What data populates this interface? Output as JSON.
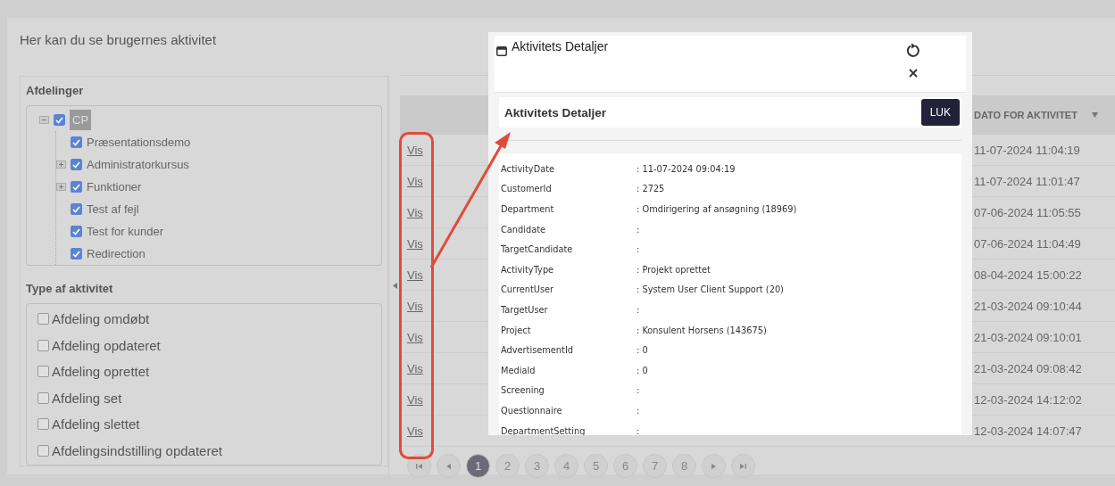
{
  "page": {
    "title": "Her kan du se brugernes aktivitet"
  },
  "departments": {
    "label": "Afdelinger",
    "tree": [
      {
        "label": "CP",
        "checked": true,
        "expanded": true,
        "children": [
          {
            "label": "Præsentationsdemo",
            "checked": true
          },
          {
            "label": "Administratorkursus",
            "checked": true,
            "expanded": false
          },
          {
            "label": "Funktioner",
            "checked": true,
            "expanded": false
          },
          {
            "label": "Test af fejl",
            "checked": true
          },
          {
            "label": "Test for kunder",
            "checked": true
          },
          {
            "label": "Redirection",
            "checked": true
          }
        ]
      }
    ]
  },
  "activity_types": {
    "label": "Type af aktivitet",
    "items": [
      {
        "label": "Afdeling omdøbt",
        "checked": false
      },
      {
        "label": "Afdeling opdateret",
        "checked": false
      },
      {
        "label": "Afdeling oprettet",
        "checked": false
      },
      {
        "label": "Afdeling set",
        "checked": false
      },
      {
        "label": "Afdeling slettet",
        "checked": false
      },
      {
        "label": "Afdelingsindstilling opdateret",
        "checked": false
      }
    ]
  },
  "table": {
    "columns": [
      {
        "label": "DATO FOR AKTIVITET",
        "sorted": true
      }
    ],
    "rows": [
      {
        "link": "Vis",
        "date": "11-07-2024 11:04:19"
      },
      {
        "link": "Vis",
        "date": "11-07-2024 11:01:47"
      },
      {
        "link": "Vis",
        "date": "07-06-2024 11:05:55"
      },
      {
        "link": "Vis",
        "date": "07-06-2024 11:04:49"
      },
      {
        "link": "Vis",
        "date": "08-04-2024 15:00:22"
      },
      {
        "link": "Vis",
        "date": "21-03-2024 09:10:44"
      },
      {
        "link": "Vis",
        "date": "21-03-2024 09:10:01"
      },
      {
        "link": "Vis",
        "date": "21-03-2024 09:08:42"
      },
      {
        "link": "Vis",
        "date": "12-03-2024 14:12:02"
      },
      {
        "link": "Vis",
        "date": "12-03-2024 14:07:47"
      }
    ]
  },
  "pagination": {
    "pages": [
      {
        "label": "1",
        "selected": true
      },
      {
        "label": "2",
        "selected": false
      },
      {
        "label": "3",
        "selected": false
      },
      {
        "label": "4",
        "selected": false
      },
      {
        "label": "5",
        "selected": false
      },
      {
        "label": "6",
        "selected": false
      },
      {
        "label": "7",
        "selected": false
      },
      {
        "label": "8",
        "selected": false
      }
    ]
  },
  "modal": {
    "window_title": "Aktivitets Detaljer",
    "heading": "Aktivitets Detaljer",
    "close_button": "LUK",
    "fields": [
      {
        "label": "ActivityDate",
        "value": ": 11-07-2024 09:04:19"
      },
      {
        "label": "CustomerId",
        "value": ": 2725"
      },
      {
        "label": "Department",
        "value": ": Omdirigering af ansøgning (18969)"
      },
      {
        "label": "Candidate",
        "value": ":"
      },
      {
        "label": "TargetCandidate",
        "value": ":"
      },
      {
        "label": "ActivityType",
        "value": ": Projekt oprettet"
      },
      {
        "label": "CurrentUser",
        "value": ": System User Client Support (20)"
      },
      {
        "label": "TargetUser",
        "value": ":"
      },
      {
        "label": "Project",
        "value": ": Konsulent Horsens (143675)"
      },
      {
        "label": "AdvertisementId",
        "value": ": 0"
      },
      {
        "label": "MediaId",
        "value": ": 0"
      },
      {
        "label": "Screening",
        "value": ":"
      },
      {
        "label": "Questionnaire",
        "value": ":"
      },
      {
        "label": "DepartmentSetting",
        "value": ":"
      }
    ]
  }
}
